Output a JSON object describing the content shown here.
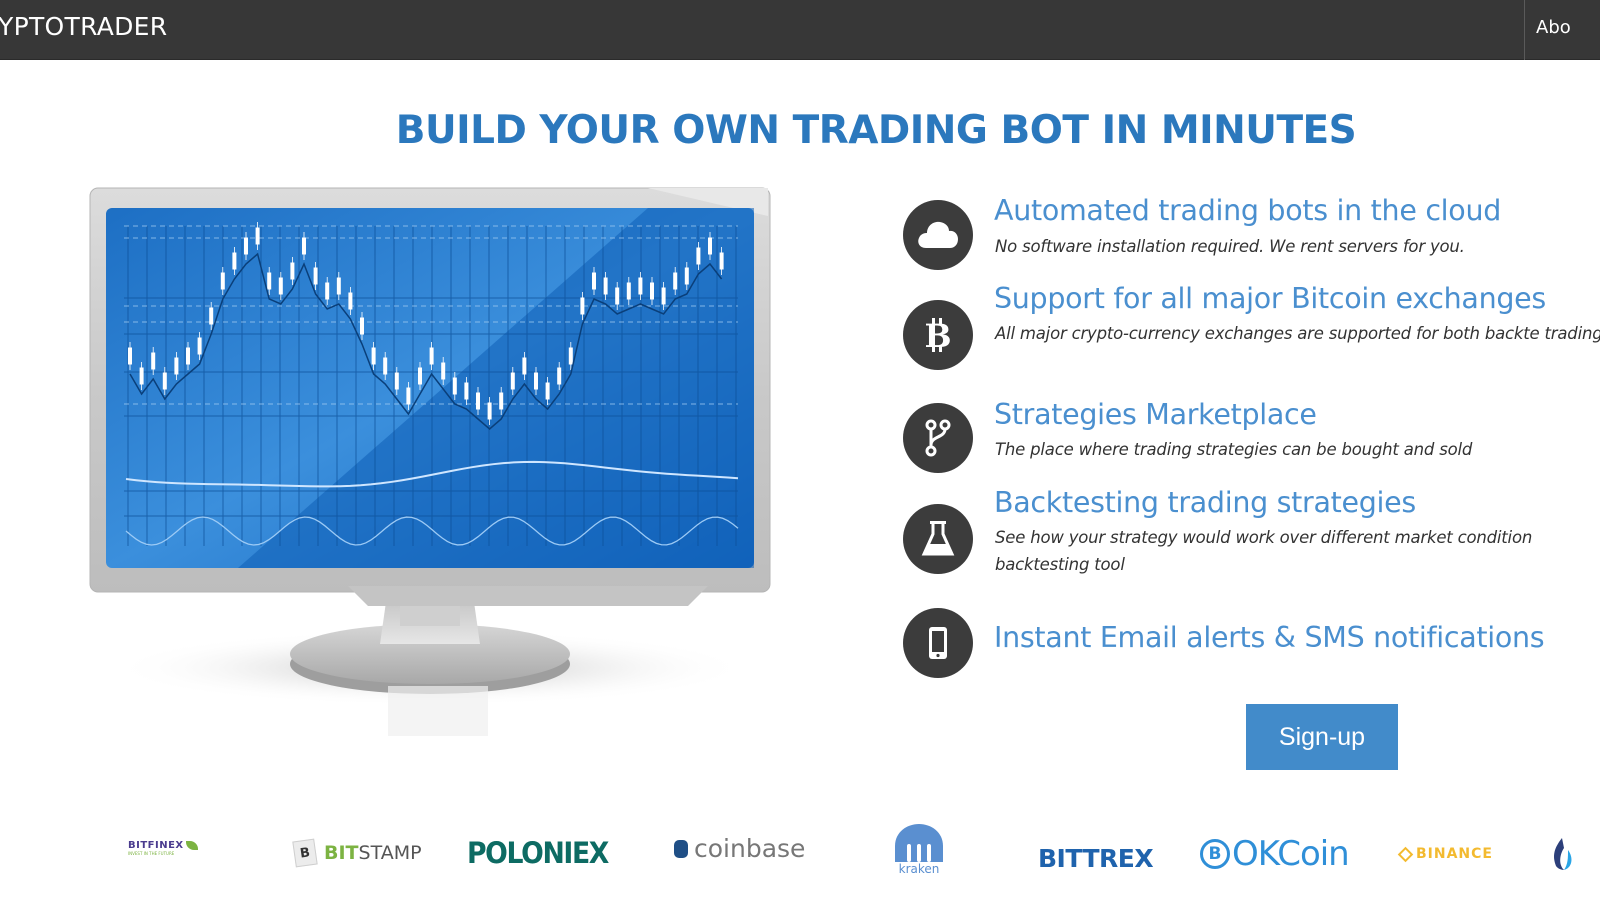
{
  "navbar": {
    "brand": "YPTOTRADER",
    "links": [
      {
        "label": "Abo"
      }
    ]
  },
  "hero": {
    "title": "BUILD YOUR OWN TRADING BOT IN MINUTES"
  },
  "features": [
    {
      "icon": "cloud-icon",
      "title": "Automated trading bots in the cloud",
      "description": "No software installation required. We rent servers for you."
    },
    {
      "icon": "bitcoin-icon",
      "title": "Support for all major Bitcoin exchanges",
      "description": "All major crypto-currency exchanges are supported for both backte trading"
    },
    {
      "icon": "code-fork-icon",
      "title": "Strategies Marketplace",
      "description": "The place where trading strategies can be bought and sold"
    },
    {
      "icon": "flask-icon",
      "title": "Backtesting trading strategies",
      "description": "See how your strategy would work over different market condition backtesting tool"
    },
    {
      "icon": "mobile-phone-icon",
      "title": "Instant Email alerts & SMS notifications",
      "description": ""
    }
  ],
  "signup_button": {
    "label": "Sign-up"
  },
  "exchanges": [
    {
      "name": "BITFINEX",
      "tagline": "INVEST IN THE FUTURE",
      "color": "#4b3c8f",
      "accent": "#7cb342"
    },
    {
      "name_a": "BIT",
      "name_b": "STAMP",
      "color_a": "#7cb342",
      "color_b": "#555555"
    },
    {
      "name": "POLONIEX",
      "color": "#0d6b63"
    },
    {
      "name": "coinbase",
      "color": "#777777",
      "accent": "#1f4f86"
    },
    {
      "name": "kraken",
      "color": "#5a8fd0"
    },
    {
      "name": "BITTREX",
      "color": "#1f63ad"
    },
    {
      "name": "OKCoin",
      "color": "#2f8fd8"
    },
    {
      "name": "BINANCE",
      "color": "#f3ba2f"
    },
    {
      "name": "Huobi",
      "color": "#2c3f7a",
      "accent": "#2aa5e6"
    }
  ]
}
